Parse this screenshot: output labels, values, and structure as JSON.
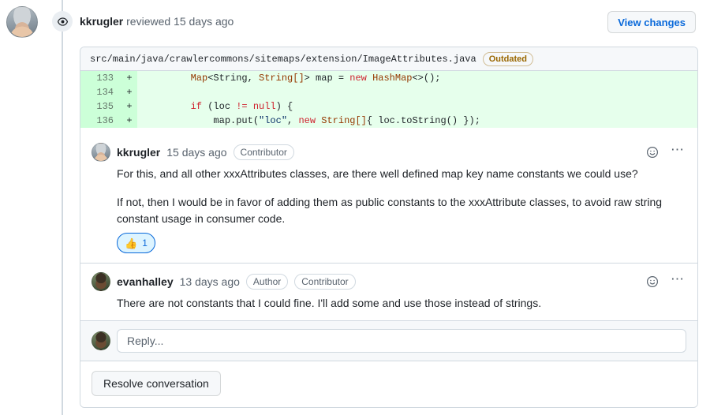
{
  "header": {
    "eye_icon": "eye-icon",
    "username": "kkrugler",
    "action_text": " reviewed 15 days ago",
    "view_changes_label": "View changes"
  },
  "file": {
    "path": "src/main/java/crawlercommons/sitemaps/extension/ImageAttributes.java",
    "status_badge": "Outdated"
  },
  "diff": {
    "lines": [
      {
        "number": "133",
        "sign": "+",
        "tokens": [
          {
            "text": "        ",
            "kind": "plain"
          },
          {
            "text": "Map",
            "kind": "type"
          },
          {
            "text": "<String, ",
            "kind": "plain"
          },
          {
            "text": "String[]",
            "kind": "type"
          },
          {
            "text": "> map = ",
            "kind": "plain"
          },
          {
            "text": "new",
            "kind": "kw"
          },
          {
            "text": " ",
            "kind": "plain"
          },
          {
            "text": "HashMap",
            "kind": "type"
          },
          {
            "text": "<>();",
            "kind": "plain"
          }
        ]
      },
      {
        "number": "134",
        "sign": "+",
        "tokens": [
          {
            "text": "",
            "kind": "plain"
          }
        ]
      },
      {
        "number": "135",
        "sign": "+",
        "tokens": [
          {
            "text": "        ",
            "kind": "plain"
          },
          {
            "text": "if",
            "kind": "kw"
          },
          {
            "text": " (loc ",
            "kind": "plain"
          },
          {
            "text": "!=",
            "kind": "kw"
          },
          {
            "text": " ",
            "kind": "plain"
          },
          {
            "text": "null",
            "kind": "kw"
          },
          {
            "text": ") {",
            "kind": "plain"
          }
        ]
      },
      {
        "number": "136",
        "sign": "+",
        "tokens": [
          {
            "text": "            map.put(",
            "kind": "plain"
          },
          {
            "text": "\"loc\"",
            "kind": "str"
          },
          {
            "text": ", ",
            "kind": "plain"
          },
          {
            "text": "new",
            "kind": "kw"
          },
          {
            "text": " ",
            "kind": "plain"
          },
          {
            "text": "String[]",
            "kind": "type"
          },
          {
            "text": "{ loc.toString() });",
            "kind": "plain"
          }
        ]
      }
    ]
  },
  "comments": [
    {
      "username": "kkrugler",
      "timestamp": "15 days ago",
      "badges": [
        "Contributor"
      ],
      "paragraphs": [
        "For this, and all other xxxAttributes classes, are there well defined map key name constants we could use?",
        "If not, then I would be in favor of adding them as public constants to the xxxAttribute classes, to avoid raw string constant usage in consumer code."
      ],
      "reaction": {
        "emoji": "👍",
        "count": "1"
      },
      "actions": {
        "reaction_icon": "smiley-icon",
        "menu_icon": "kebab-menu-icon"
      }
    },
    {
      "username": "evanhalley",
      "timestamp": "13 days ago",
      "badges": [
        "Author",
        "Contributor"
      ],
      "paragraphs": [
        "There are not constants that I could fine. I'll add some and use those instead of strings."
      ],
      "reaction": null,
      "actions": {
        "reaction_icon": "smiley-icon",
        "menu_icon": "kebab-menu-icon"
      }
    }
  ],
  "reply": {
    "placeholder": "Reply...",
    "value": ""
  },
  "resolve": {
    "label": "Resolve conversation"
  },
  "colors": {
    "accent": "#0969da",
    "diff_add_bg": "#e6ffec",
    "diff_add_gutter": "#ccffd8",
    "outdated": "#9a6700",
    "border": "#d1d9e0",
    "muted_text": "#59636e"
  }
}
